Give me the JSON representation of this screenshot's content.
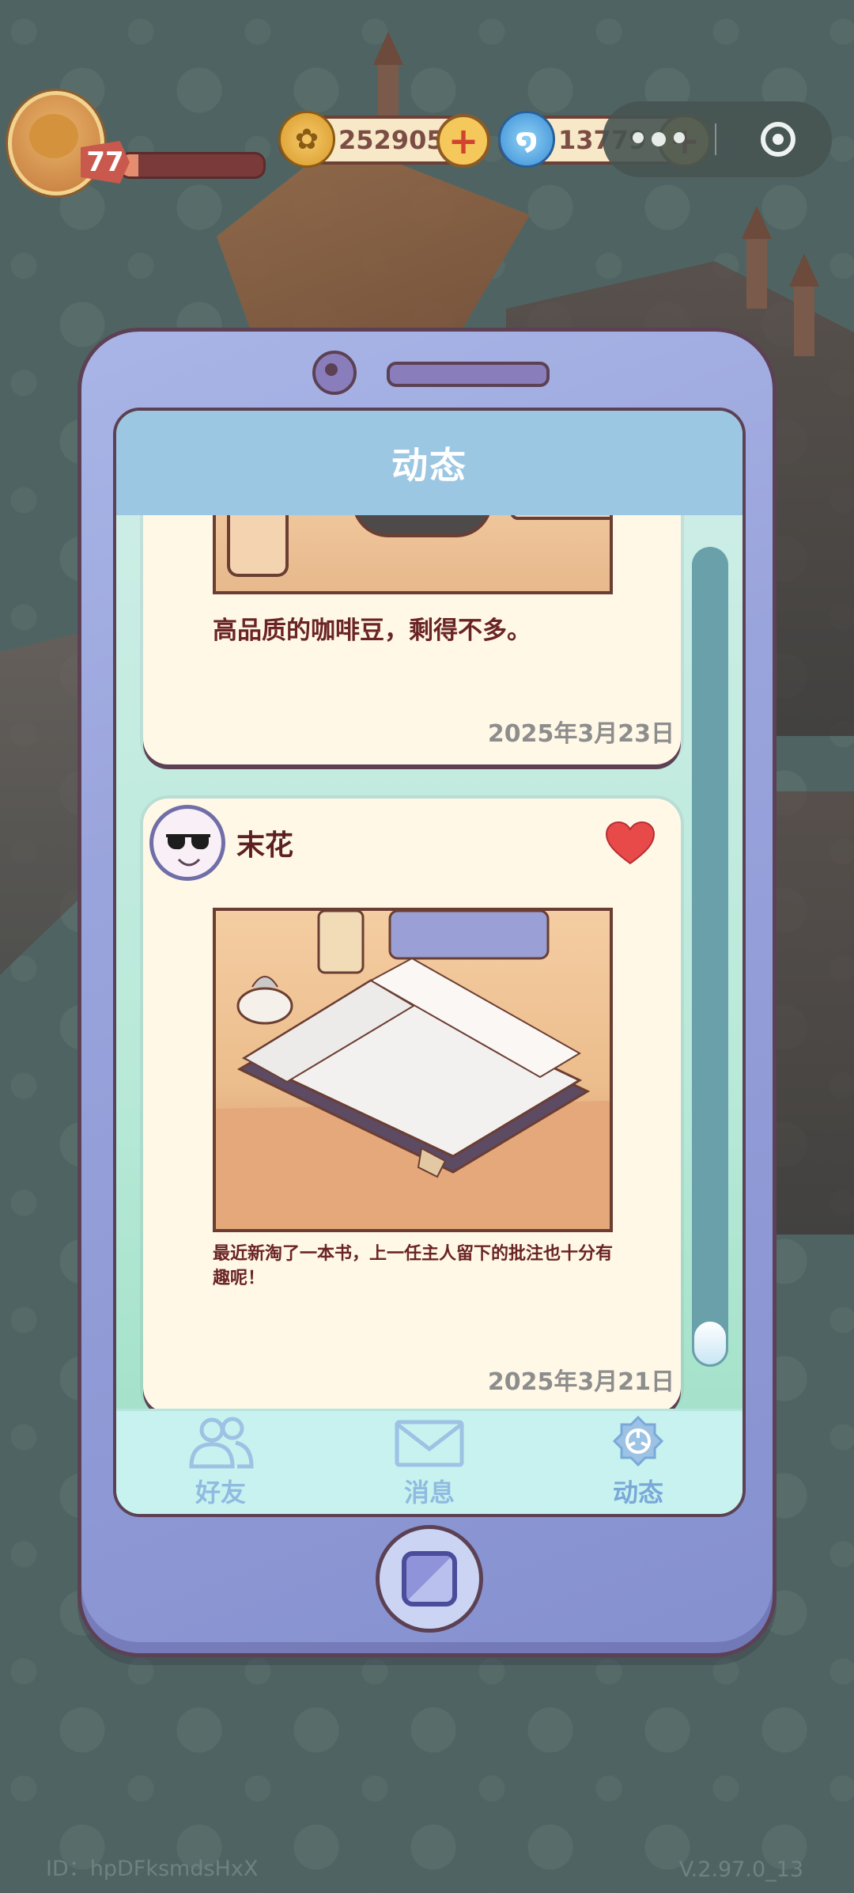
{
  "hud": {
    "level": "77",
    "level_progress": 0.12,
    "coins": "252905",
    "gems": "13779"
  },
  "screen": {
    "title": "动态"
  },
  "posts": [
    {
      "author": "",
      "text": "高品质的咖啡豆，剩得不多。",
      "date": "2025年3月23日"
    },
    {
      "author": "末花",
      "text": "最近新淘了一本书，上一任主人留下的批注也十分有趣呢！",
      "date": "2025年3月21日",
      "liked": true
    }
  ],
  "tabs": [
    {
      "label": "好友",
      "icon": "friends-icon"
    },
    {
      "label": "消息",
      "icon": "mail-icon"
    },
    {
      "label": "动态",
      "icon": "moments-icon",
      "active": true
    }
  ],
  "footer": {
    "id": "ID：hpDFksmdsHxX",
    "version": "V.2.97.0_13"
  },
  "colors": {
    "background": "#4f6462",
    "phone_frame": "#9aa4dc",
    "header": "#9cc7e2",
    "like": "#e84a4a",
    "tab_label": "#8fbbe0"
  }
}
